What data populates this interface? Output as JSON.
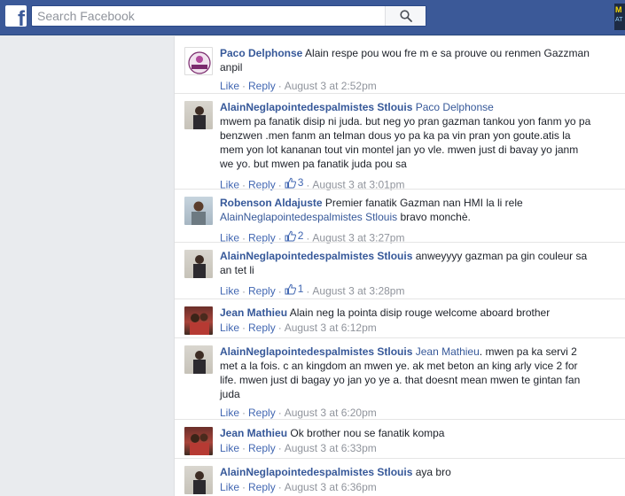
{
  "search": {
    "placeholder": "Search Facebook"
  },
  "logo": {
    "letter": "f"
  },
  "corner_badge": {
    "line1": "M",
    "line2": "AT"
  },
  "comments": [
    {
      "author": "Paco Delphonse",
      "mention": "",
      "text": "Alain respe pou wou fre m e sa prouve ou renmen Gazzman anpil",
      "like": "Like",
      "reply": "Reply",
      "likes": "",
      "time": "August 3 at 2:52pm"
    },
    {
      "author": "AlainNeglapointedespalmistes Stlouis",
      "mention": "Paco Delphonse",
      "text": "mwem pa fanatik disip ni juda. but neg yo pran gazman tankou yon fanm yo pa benzwen .men fanm an telman dous yo pa ka pa vin pran yon goute.atis la mem yon lot kananan tout vin montel jan yo vle. mwen just di bavay yo janm we yo. but mwen pa fanatik juda pou sa",
      "like": "Like",
      "reply": "Reply",
      "likes": "3",
      "time": "August 3 at 3:01pm"
    },
    {
      "author": "Robenson Aldajuste",
      "mention": "AlainNeglapointedespalmistes Stlouis",
      "text_pre": "Premier fanatik Gazman nan HMI la li rele",
      "text": "bravo monchè.",
      "like": "Like",
      "reply": "Reply",
      "likes": "2",
      "time": "August 3 at 3:27pm"
    },
    {
      "author": "AlainNeglapointedespalmistes Stlouis",
      "mention": "",
      "text": "anweyyyy gazman pa gin couleur sa an tet li",
      "like": "Like",
      "reply": "Reply",
      "likes": "1",
      "time": "August 3 at 3:28pm"
    },
    {
      "author": "Jean Mathieu",
      "mention": "",
      "text": "Alain neg la pointa disip rouge welcome aboard brother",
      "like": "Like",
      "reply": "Reply",
      "likes": "",
      "time": "August 3 at 6:12pm"
    },
    {
      "author": "AlainNeglapointedespalmistes Stlouis",
      "mention": "Jean Mathieu",
      "text": ". mwen pa ka servi 2 met a la fois. c an kingdom an mwen ye. ak met beton an king arly vice 2 for life. mwen just di bagay yo jan yo ye a. that doesnt mean mwen te gintan fan juda",
      "like": "Like",
      "reply": "Reply",
      "likes": "",
      "time": "August 3 at 6:20pm"
    },
    {
      "author": "Jean Mathieu",
      "mention": "",
      "text": "Ok brother nou se fanatik kompa",
      "like": "Like",
      "reply": "Reply",
      "likes": "",
      "time": "August 3 at 6:33pm"
    },
    {
      "author": "AlainNeglapointedespalmistes Stlouis",
      "mention": "",
      "text": "aya bro",
      "like": "Like",
      "reply": "Reply",
      "likes": "",
      "time": "August 3 at 6:36pm"
    }
  ],
  "icons": {
    "search": "search-icon",
    "thumbs_up": "thumbs-up-icon"
  },
  "colors": {
    "topbar": "#3b5998",
    "link": "#365899",
    "action": "#4267b2",
    "meta": "#90949c"
  }
}
